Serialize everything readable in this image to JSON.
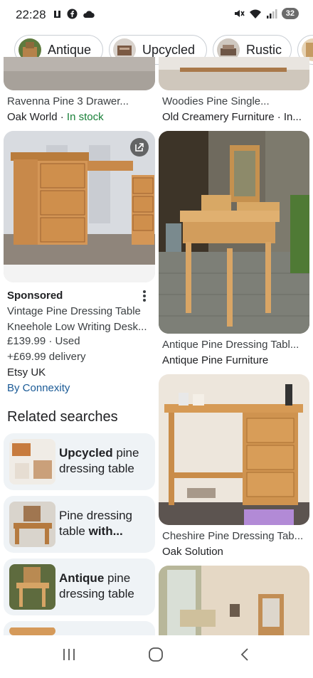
{
  "status": {
    "time": "22:28",
    "battery": "32"
  },
  "chips": [
    {
      "label": "Antique"
    },
    {
      "label": "Upcycled"
    },
    {
      "label": "Rustic"
    }
  ],
  "results": {
    "top_left": {
      "title": "Ravenna Pine 3 Drawer...",
      "source": "Oak World",
      "stock": "In stock"
    },
    "top_right": {
      "title": "Woodies Pine Single...",
      "source": "Old Creamery Furniture · In..."
    },
    "ad": {
      "sponsored": "Sponsored",
      "title_line1": "Vintage Pine Dressing Table",
      "title_line2": "Kneehole Low Writing Desk...",
      "price": "£139.99 · Used",
      "delivery": "+£69.99 delivery",
      "seller": "Etsy UK",
      "by": "By Connexity"
    },
    "right_1": {
      "title": "Antique Pine Dressing Tabl...",
      "source": "Antique Pine Furniture"
    },
    "right_2": {
      "title": "Cheshire Pine Dressing Tab...",
      "source": "Oak Solution"
    }
  },
  "related": {
    "title": "Related searches",
    "items": [
      {
        "bold": "Upcycled",
        "rest": " pine dressing table",
        "bold_first": true
      },
      {
        "bold": "with...",
        "rest": "Pine dressing table ",
        "bold_first": false
      },
      {
        "bold": "Antique",
        "rest": " pine dressing table",
        "bold_first": true
      }
    ]
  },
  "colors": {
    "accent_link": "#1a5a96",
    "in_stock": "#188038",
    "card_bg": "#eff3f6"
  }
}
